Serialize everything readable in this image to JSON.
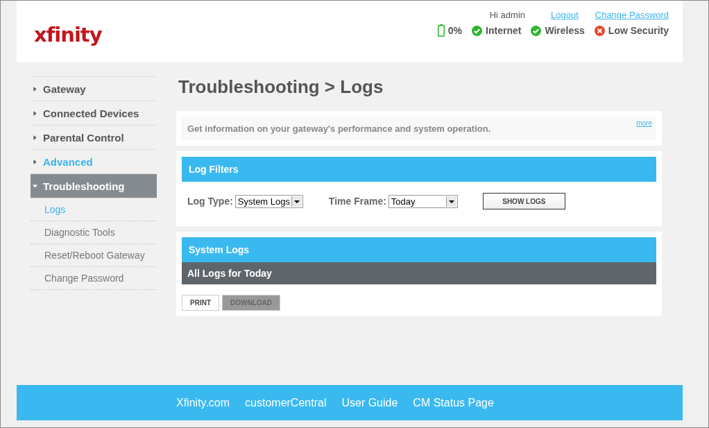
{
  "header": {
    "logo": "xfinity",
    "greeting": "Hi admin",
    "links": [
      "Logout",
      "Change Password"
    ],
    "status": [
      {
        "kind": "battery",
        "label": "0%"
      },
      {
        "kind": "ok",
        "label": "Internet"
      },
      {
        "kind": "ok",
        "label": "Wireless"
      },
      {
        "kind": "error",
        "label": "Low Security"
      }
    ]
  },
  "sidebar": {
    "items": [
      {
        "label": "Gateway",
        "selected": false,
        "highlighted": false,
        "expanded": false
      },
      {
        "label": "Connected Devices",
        "selected": false,
        "highlighted": false,
        "expanded": false
      },
      {
        "label": "Parental Control",
        "selected": false,
        "highlighted": false,
        "expanded": false
      },
      {
        "label": "Advanced",
        "selected": false,
        "highlighted": true,
        "expanded": false
      },
      {
        "label": "Troubleshooting",
        "selected": true,
        "highlighted": false,
        "expanded": true,
        "children": [
          {
            "label": "Logs",
            "selected": true
          },
          {
            "label": "Diagnostic Tools",
            "selected": false
          },
          {
            "label": "Reset/Reboot Gateway",
            "selected": false
          },
          {
            "label": "Change Password",
            "selected": false
          }
        ]
      }
    ]
  },
  "page_title": "Troubleshooting > Logs",
  "info": {
    "text": "Get information on your gateway's performance and system operation.",
    "more": "more"
  },
  "filters": {
    "title": "Log Filters",
    "log_type": {
      "label": "Log Type:",
      "value": "System Logs"
    },
    "time_frame": {
      "label": "Time Frame:",
      "value": "Today"
    },
    "button": "SHOW LOGS"
  },
  "logs": {
    "title": "System Logs",
    "subtitle": "All Logs for Today",
    "buttons": [
      {
        "label": "PRINT",
        "disabled": false
      },
      {
        "label": "DOWNLOAD",
        "disabled": true
      }
    ]
  },
  "footer": {
    "links": [
      "Xfinity.com",
      "customerCentral",
      "User Guide",
      "CM Status Page"
    ]
  }
}
